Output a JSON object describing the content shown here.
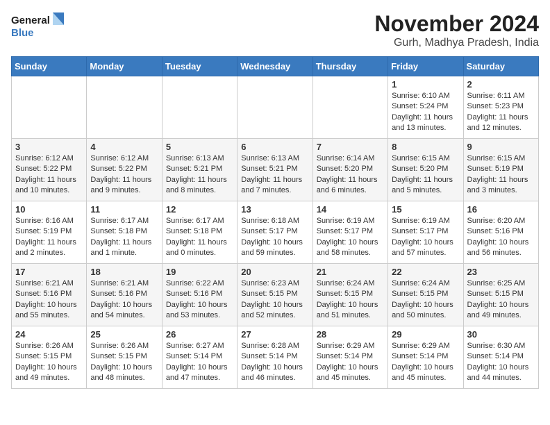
{
  "logo": {
    "line1": "General",
    "line2": "Blue"
  },
  "title": {
    "month_year": "November 2024",
    "location": "Gurh, Madhya Pradesh, India"
  },
  "days_of_week": [
    "Sunday",
    "Monday",
    "Tuesday",
    "Wednesday",
    "Thursday",
    "Friday",
    "Saturday"
  ],
  "weeks": [
    [
      {
        "day": "",
        "info": ""
      },
      {
        "day": "",
        "info": ""
      },
      {
        "day": "",
        "info": ""
      },
      {
        "day": "",
        "info": ""
      },
      {
        "day": "",
        "info": ""
      },
      {
        "day": "1",
        "info": "Sunrise: 6:10 AM\nSunset: 5:24 PM\nDaylight: 11 hours\nand 13 minutes."
      },
      {
        "day": "2",
        "info": "Sunrise: 6:11 AM\nSunset: 5:23 PM\nDaylight: 11 hours\nand 12 minutes."
      }
    ],
    [
      {
        "day": "3",
        "info": "Sunrise: 6:12 AM\nSunset: 5:22 PM\nDaylight: 11 hours\nand 10 minutes."
      },
      {
        "day": "4",
        "info": "Sunrise: 6:12 AM\nSunset: 5:22 PM\nDaylight: 11 hours\nand 9 minutes."
      },
      {
        "day": "5",
        "info": "Sunrise: 6:13 AM\nSunset: 5:21 PM\nDaylight: 11 hours\nand 8 minutes."
      },
      {
        "day": "6",
        "info": "Sunrise: 6:13 AM\nSunset: 5:21 PM\nDaylight: 11 hours\nand 7 minutes."
      },
      {
        "day": "7",
        "info": "Sunrise: 6:14 AM\nSunset: 5:20 PM\nDaylight: 11 hours\nand 6 minutes."
      },
      {
        "day": "8",
        "info": "Sunrise: 6:15 AM\nSunset: 5:20 PM\nDaylight: 11 hours\nand 5 minutes."
      },
      {
        "day": "9",
        "info": "Sunrise: 6:15 AM\nSunset: 5:19 PM\nDaylight: 11 hours\nand 3 minutes."
      }
    ],
    [
      {
        "day": "10",
        "info": "Sunrise: 6:16 AM\nSunset: 5:19 PM\nDaylight: 11 hours\nand 2 minutes."
      },
      {
        "day": "11",
        "info": "Sunrise: 6:17 AM\nSunset: 5:18 PM\nDaylight: 11 hours\nand 1 minute."
      },
      {
        "day": "12",
        "info": "Sunrise: 6:17 AM\nSunset: 5:18 PM\nDaylight: 11 hours\nand 0 minutes."
      },
      {
        "day": "13",
        "info": "Sunrise: 6:18 AM\nSunset: 5:17 PM\nDaylight: 10 hours\nand 59 minutes."
      },
      {
        "day": "14",
        "info": "Sunrise: 6:19 AM\nSunset: 5:17 PM\nDaylight: 10 hours\nand 58 minutes."
      },
      {
        "day": "15",
        "info": "Sunrise: 6:19 AM\nSunset: 5:17 PM\nDaylight: 10 hours\nand 57 minutes."
      },
      {
        "day": "16",
        "info": "Sunrise: 6:20 AM\nSunset: 5:16 PM\nDaylight: 10 hours\nand 56 minutes."
      }
    ],
    [
      {
        "day": "17",
        "info": "Sunrise: 6:21 AM\nSunset: 5:16 PM\nDaylight: 10 hours\nand 55 minutes."
      },
      {
        "day": "18",
        "info": "Sunrise: 6:21 AM\nSunset: 5:16 PM\nDaylight: 10 hours\nand 54 minutes."
      },
      {
        "day": "19",
        "info": "Sunrise: 6:22 AM\nSunset: 5:16 PM\nDaylight: 10 hours\nand 53 minutes."
      },
      {
        "day": "20",
        "info": "Sunrise: 6:23 AM\nSunset: 5:15 PM\nDaylight: 10 hours\nand 52 minutes."
      },
      {
        "day": "21",
        "info": "Sunrise: 6:24 AM\nSunset: 5:15 PM\nDaylight: 10 hours\nand 51 minutes."
      },
      {
        "day": "22",
        "info": "Sunrise: 6:24 AM\nSunset: 5:15 PM\nDaylight: 10 hours\nand 50 minutes."
      },
      {
        "day": "23",
        "info": "Sunrise: 6:25 AM\nSunset: 5:15 PM\nDaylight: 10 hours\nand 49 minutes."
      }
    ],
    [
      {
        "day": "24",
        "info": "Sunrise: 6:26 AM\nSunset: 5:15 PM\nDaylight: 10 hours\nand 49 minutes."
      },
      {
        "day": "25",
        "info": "Sunrise: 6:26 AM\nSunset: 5:15 PM\nDaylight: 10 hours\nand 48 minutes."
      },
      {
        "day": "26",
        "info": "Sunrise: 6:27 AM\nSunset: 5:14 PM\nDaylight: 10 hours\nand 47 minutes."
      },
      {
        "day": "27",
        "info": "Sunrise: 6:28 AM\nSunset: 5:14 PM\nDaylight: 10 hours\nand 46 minutes."
      },
      {
        "day": "28",
        "info": "Sunrise: 6:29 AM\nSunset: 5:14 PM\nDaylight: 10 hours\nand 45 minutes."
      },
      {
        "day": "29",
        "info": "Sunrise: 6:29 AM\nSunset: 5:14 PM\nDaylight: 10 hours\nand 45 minutes."
      },
      {
        "day": "30",
        "info": "Sunrise: 6:30 AM\nSunset: 5:14 PM\nDaylight: 10 hours\nand 44 minutes."
      }
    ]
  ]
}
